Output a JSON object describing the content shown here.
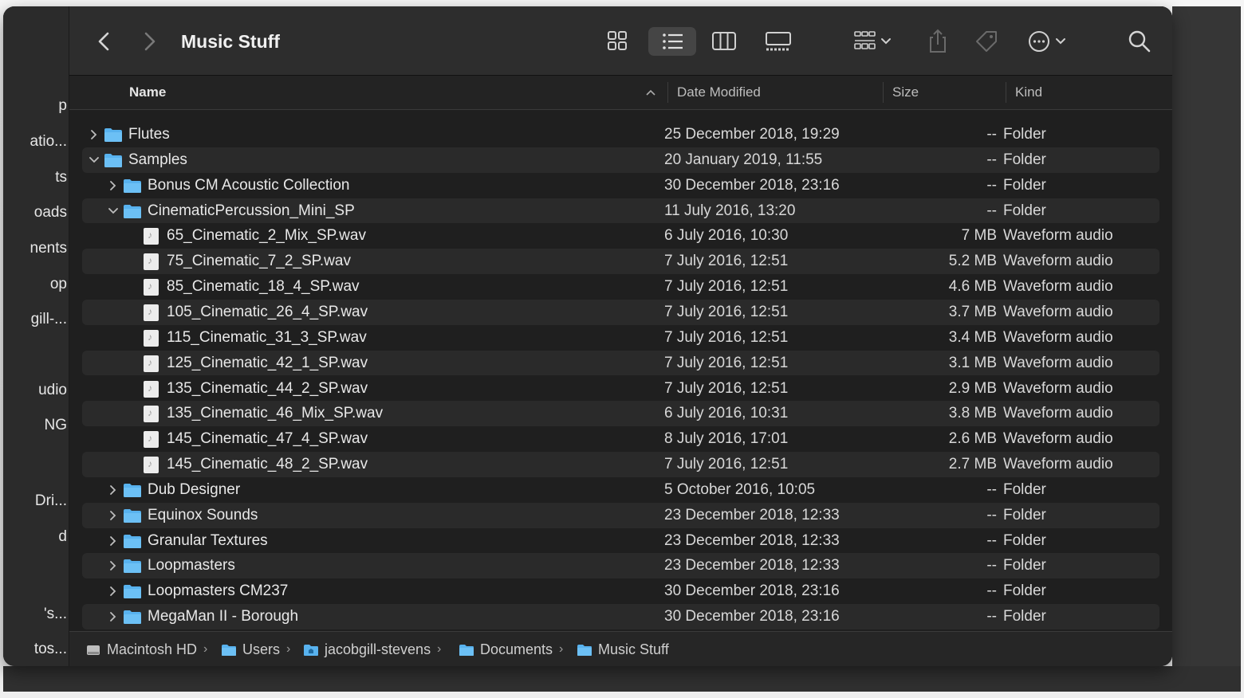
{
  "window": {
    "title": "Music Stuff"
  },
  "sidebar": {
    "items": [
      "p",
      "atio...",
      "ts",
      "oads",
      "nents",
      "op",
      "gill-...",
      "udio",
      "NG",
      "Dri...",
      "d",
      "'s...",
      "tos..."
    ]
  },
  "toolbar": {
    "icons": [
      "back-chevron-icon",
      "forward-chevron-icon",
      "icon-view-icon",
      "list-view-icon",
      "column-view-icon",
      "gallery-view-icon",
      "group-by-icon",
      "share-icon",
      "tag-icon",
      "more-actions-icon",
      "search-icon"
    ]
  },
  "columns": {
    "name": "Name",
    "date": "Date Modified",
    "size": "Size",
    "kind": "Kind"
  },
  "rows": [
    {
      "name": "Flutes",
      "date": "25 December 2018, 19:29",
      "size": "--",
      "kind": "Folder",
      "type": "folder",
      "depth": 0,
      "expanded": false
    },
    {
      "name": "Samples",
      "date": "20 January 2019, 11:55",
      "size": "--",
      "kind": "Folder",
      "type": "folder",
      "depth": 0,
      "expanded": true
    },
    {
      "name": "Bonus CM Acoustic Collection",
      "date": "30 December 2018, 23:16",
      "size": "--",
      "kind": "Folder",
      "type": "folder",
      "depth": 1,
      "expanded": false
    },
    {
      "name": "CinematicPercussion_Mini_SP",
      "date": "11 July 2016, 13:20",
      "size": "--",
      "kind": "Folder",
      "type": "folder",
      "depth": 1,
      "expanded": true
    },
    {
      "name": "65_Cinematic_2_Mix_SP.wav",
      "date": "6 July 2016, 10:30",
      "size": "7 MB",
      "kind": "Waveform audio",
      "type": "file",
      "depth": 2
    },
    {
      "name": "75_Cinematic_7_2_SP.wav",
      "date": "7 July 2016, 12:51",
      "size": "5.2 MB",
      "kind": "Waveform audio",
      "type": "file",
      "depth": 2
    },
    {
      "name": "85_Cinematic_18_4_SP.wav",
      "date": "7 July 2016, 12:51",
      "size": "4.6 MB",
      "kind": "Waveform audio",
      "type": "file",
      "depth": 2
    },
    {
      "name": "105_Cinematic_26_4_SP.wav",
      "date": "7 July 2016, 12:51",
      "size": "3.7 MB",
      "kind": "Waveform audio",
      "type": "file",
      "depth": 2
    },
    {
      "name": "115_Cinematic_31_3_SP.wav",
      "date": "7 July 2016, 12:51",
      "size": "3.4 MB",
      "kind": "Waveform audio",
      "type": "file",
      "depth": 2
    },
    {
      "name": "125_Cinematic_42_1_SP.wav",
      "date": "7 July 2016, 12:51",
      "size": "3.1 MB",
      "kind": "Waveform audio",
      "type": "file",
      "depth": 2
    },
    {
      "name": "135_Cinematic_44_2_SP.wav",
      "date": "7 July 2016, 12:51",
      "size": "2.9 MB",
      "kind": "Waveform audio",
      "type": "file",
      "depth": 2
    },
    {
      "name": "135_Cinematic_46_Mix_SP.wav",
      "date": "6 July 2016, 10:31",
      "size": "3.8 MB",
      "kind": "Waveform audio",
      "type": "file",
      "depth": 2
    },
    {
      "name": "145_Cinematic_47_4_SP.wav",
      "date": "8 July 2016, 17:01",
      "size": "2.6 MB",
      "kind": "Waveform audio",
      "type": "file",
      "depth": 2
    },
    {
      "name": "145_Cinematic_48_2_SP.wav",
      "date": "7 July 2016, 12:51",
      "size": "2.7 MB",
      "kind": "Waveform audio",
      "type": "file",
      "depth": 2
    },
    {
      "name": "Dub Designer",
      "date": "5 October 2016, 10:05",
      "size": "--",
      "kind": "Folder",
      "type": "folder",
      "depth": 1,
      "expanded": false
    },
    {
      "name": "Equinox Sounds",
      "date": "23 December 2018, 12:33",
      "size": "--",
      "kind": "Folder",
      "type": "folder",
      "depth": 1,
      "expanded": false
    },
    {
      "name": "Granular Textures",
      "date": "23 December 2018, 12:33",
      "size": "--",
      "kind": "Folder",
      "type": "folder",
      "depth": 1,
      "expanded": false
    },
    {
      "name": "Loopmasters",
      "date": "23 December 2018, 12:33",
      "size": "--",
      "kind": "Folder",
      "type": "folder",
      "depth": 1,
      "expanded": false
    },
    {
      "name": "Loopmasters CM237",
      "date": "30 December 2018, 23:16",
      "size": "--",
      "kind": "Folder",
      "type": "folder",
      "depth": 1,
      "expanded": false
    },
    {
      "name": "MegaMan II - Borough",
      "date": "30 December 2018, 23:16",
      "size": "--",
      "kind": "Folder",
      "type": "folder",
      "depth": 1,
      "expanded": false
    }
  ],
  "pathbar": {
    "crumbs": [
      {
        "label": "Macintosh HD",
        "icon": "disk-icon"
      },
      {
        "label": "Users",
        "icon": "folder-icon"
      },
      {
        "label": "jacobgill-stevens",
        "icon": "home-folder-icon"
      },
      {
        "label": "Documents",
        "icon": "folder-icon"
      },
      {
        "label": "Music Stuff",
        "icon": "folder-icon"
      }
    ]
  },
  "colors": {
    "folder": "#58b2ee",
    "window_bg": "#1f1f1f",
    "text": "#e8e8e8"
  }
}
